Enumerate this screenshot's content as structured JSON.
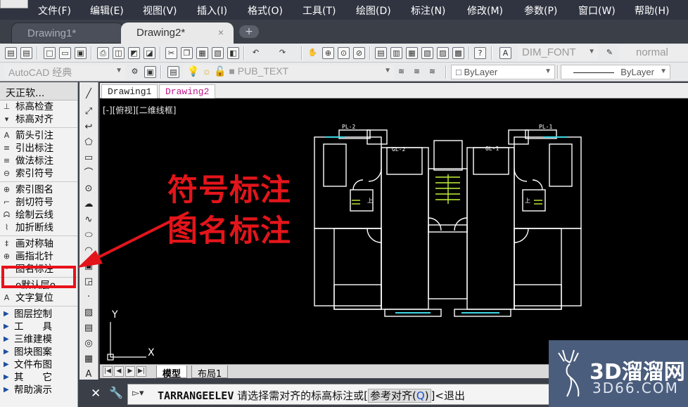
{
  "menu": [
    "文件(F)",
    "编辑(E)",
    "视图(V)",
    "插入(I)",
    "格式(O)",
    "工具(T)",
    "绘图(D)",
    "标注(N)",
    "修改(M)",
    "参数(P)",
    "窗口(W)",
    "帮助(H)"
  ],
  "tabs": {
    "tab1": "Drawing1*",
    "tab2": "Drawing2*",
    "close": "×",
    "new_tab": "+"
  },
  "toolbar1": {
    "dim_style": "DIM_FONT",
    "normal": "normal"
  },
  "toolbar2": {
    "workspace": "AutoCAD 经典",
    "layer": "PUB_TEXT",
    "color": "ByLayer",
    "linetype": "ByLayer"
  },
  "palette": {
    "title": "天正软...",
    "groups": [
      [
        "标高检查",
        "标高对齐"
      ],
      [
        "箭头引注",
        "引出标注",
        "做法标注",
        "索引符号"
      ],
      [
        "索引图名",
        "剖切符号",
        "绘制云线",
        "加折断线"
      ],
      [
        "画对称轴",
        "画指北针",
        "图名标注"
      ],
      [
        "o默认层o",
        "文字复位"
      ]
    ],
    "categories": [
      "图层控制",
      "工　　具",
      "三维建模",
      "图块图案",
      "文件布图",
      "其　　它",
      "帮助演示"
    ]
  },
  "drawing_tabs": {
    "t1": "Drawing1",
    "t2": "Drawing2"
  },
  "view_label": "[-][俯视][二维线框]",
  "plan_labels": {
    "pl_left": "PL-2",
    "pl_right": "PL-1",
    "gl_left": "GL-2",
    "gl_right": "GL-1",
    "mark_left": "上",
    "mark_right": "上"
  },
  "ucs": {
    "x": "X",
    "y": "Y"
  },
  "layout_tabs": {
    "model": "模型",
    "layout1": "布局1"
  },
  "command_line": {
    "prompt": "▻▾",
    "command": "TARRANGEELEV",
    "text": "请选择需对齐的标高标注或[",
    "option": "参考对齐(",
    "key": "Q",
    "option_close": ")",
    "tail": "]<退出"
  },
  "annotations": {
    "line1": "符号标注",
    "line2": "图名标注"
  },
  "watermark": {
    "brand": "3D溜溜网",
    "url": "3D66.COM"
  },
  "colors": {
    "accent_red": "#e3151a",
    "canvas_bg": "#000000",
    "plan_lines": "#ffffff",
    "window_cyan": "#3fd7e6",
    "stair_green": "#c6f23a",
    "menubar_bg": "#2f3440"
  }
}
